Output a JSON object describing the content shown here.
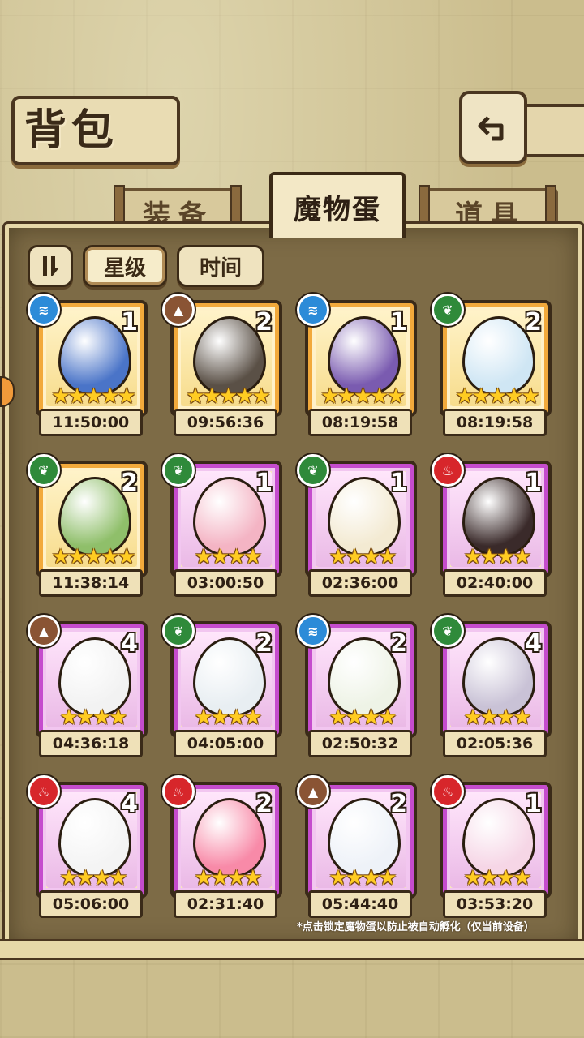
{
  "header": {
    "title": "背包",
    "back_icon": "back-arrow-icon"
  },
  "tabs": [
    {
      "label": "装备",
      "active": false
    },
    {
      "label": "魔物蛋",
      "active": true
    },
    {
      "label": "道具",
      "active": false
    }
  ],
  "sort": {
    "toggle_icon": "sort-order-icon",
    "star_label": "星级",
    "time_label": "时间",
    "active": "星级"
  },
  "eggs": [
    {
      "element": "water",
      "count": "1",
      "stars": "★★★★★",
      "time": "11:50:00",
      "frame": "gold",
      "color": "#4a74c8"
    },
    {
      "element": "earth",
      "count": "2",
      "stars": "★★★★★",
      "time": "09:56:36",
      "frame": "gold",
      "color": "#5a5046"
    },
    {
      "element": "water",
      "count": "1",
      "stars": "★★★★★",
      "time": "08:19:58",
      "frame": "gold",
      "color": "#7a5bb0"
    },
    {
      "element": "grass",
      "count": "2",
      "stars": "★★★★★",
      "time": "08:19:58",
      "frame": "gold",
      "color": "#cfe6f4"
    },
    {
      "element": "grass",
      "count": "2",
      "stars": "★★★★★",
      "time": "11:38:14",
      "frame": "gold",
      "color": "#8fbf6a"
    },
    {
      "element": "grass",
      "count": "1",
      "stars": "★★★★",
      "time": "03:00:50",
      "frame": "purple",
      "color": "#f4b4c4"
    },
    {
      "element": "grass",
      "count": "1",
      "stars": "★★★★",
      "time": "02:36:00",
      "frame": "purple",
      "color": "#f3ead2"
    },
    {
      "element": "fire",
      "count": "1",
      "stars": "★★★★",
      "time": "02:40:00",
      "frame": "purple",
      "color": "#3a2a2a"
    },
    {
      "element": "earth",
      "count": "4",
      "stars": "★★★★",
      "time": "04:36:18",
      "frame": "purple",
      "color": "#f2f2f2"
    },
    {
      "element": "grass",
      "count": "2",
      "stars": "★★★★",
      "time": "04:05:00",
      "frame": "purple",
      "color": "#e8eef2"
    },
    {
      "element": "water",
      "count": "2",
      "stars": "★★★★",
      "time": "02:50:32",
      "frame": "purple",
      "color": "#eef3e6"
    },
    {
      "element": "grass",
      "count": "4",
      "stars": "★★★★",
      "time": "02:05:36",
      "frame": "purple",
      "color": "#c9c2d6"
    },
    {
      "element": "fire",
      "count": "4",
      "stars": "★★★★",
      "time": "05:06:00",
      "frame": "purple",
      "color": "#f4f4f4"
    },
    {
      "element": "fire",
      "count": "2",
      "stars": "★★★★",
      "time": "02:31:40",
      "frame": "purple",
      "color": "#f88aa8"
    },
    {
      "element": "earth",
      "count": "2",
      "stars": "★★★★",
      "time": "05:44:40",
      "frame": "purple",
      "color": "#eef2f8"
    },
    {
      "element": "fire",
      "count": "1",
      "stars": "★★★★",
      "time": "03:53:20",
      "frame": "purple",
      "color": "#f6d6e6"
    }
  ],
  "footer_note": "*点击锁定魔物蛋以防止被自动孵化（仅当前设备）"
}
